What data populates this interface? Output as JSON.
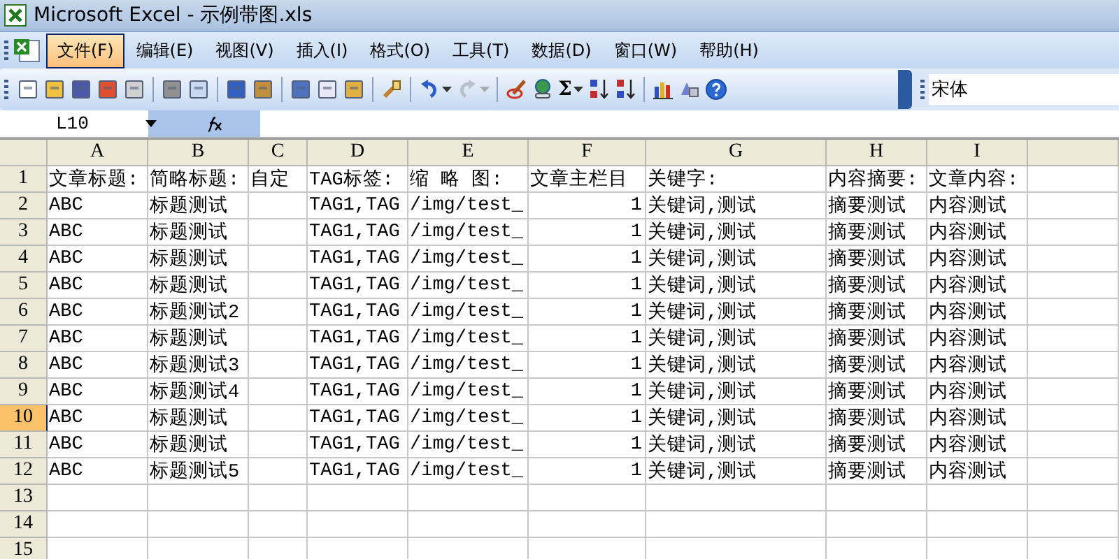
{
  "window": {
    "title": "Microsoft Excel - 示例带图.xls"
  },
  "menu": [
    {
      "label": "文件(F)",
      "selected": true
    },
    {
      "label": "编辑(E)",
      "selected": false
    },
    {
      "label": "视图(V)",
      "selected": false
    },
    {
      "label": "插入(I)",
      "selected": false
    },
    {
      "label": "格式(O)",
      "selected": false
    },
    {
      "label": "工具(T)",
      "selected": false
    },
    {
      "label": "数据(D)",
      "selected": false
    },
    {
      "label": "窗口(W)",
      "selected": false
    },
    {
      "label": "帮助(H)",
      "selected": false
    }
  ],
  "toolbar": {
    "sum_symbol": "Σ",
    "font_name": "宋体"
  },
  "formula_bar": {
    "name_box": "L10"
  },
  "columns": [
    "A",
    "B",
    "C",
    "D",
    "E",
    "F",
    "G",
    "H",
    "I"
  ],
  "rows": [
    {
      "number": "1",
      "selected": false,
      "cells": [
        "文章标题:",
        "简略标题:",
        "自定",
        "TAG标签:",
        "缩 略 图:",
        "文章主栏目",
        "关键字:",
        "内容摘要:",
        "文章内容:"
      ]
    },
    {
      "number": "2",
      "selected": false,
      "cells": [
        "ABC",
        "标题测试",
        "",
        "TAG1,TAG",
        "/img/test_",
        "1",
        "关键词,测试",
        "摘要测试",
        "内容测试"
      ]
    },
    {
      "number": "3",
      "selected": false,
      "cells": [
        "ABC",
        "标题测试",
        "",
        "TAG1,TAG",
        "/img/test_",
        "1",
        "关键词,测试",
        "摘要测试",
        "内容测试"
      ]
    },
    {
      "number": "4",
      "selected": false,
      "cells": [
        "ABC",
        "标题测试",
        "",
        "TAG1,TAG",
        "/img/test_",
        "1",
        "关键词,测试",
        "摘要测试",
        "内容测试"
      ]
    },
    {
      "number": "5",
      "selected": false,
      "cells": [
        "ABC",
        "标题测试",
        "",
        "TAG1,TAG",
        "/img/test_",
        "1",
        "关键词,测试",
        "摘要测试",
        "内容测试"
      ]
    },
    {
      "number": "6",
      "selected": false,
      "cells": [
        "ABC",
        "标题测试2",
        "",
        "TAG1,TAG",
        "/img/test_",
        "1",
        "关键词,测试",
        "摘要测试",
        "内容测试"
      ]
    },
    {
      "number": "7",
      "selected": false,
      "cells": [
        "ABC",
        "标题测试",
        "",
        "TAG1,TAG",
        "/img/test_",
        "1",
        "关键词,测试",
        "摘要测试",
        "内容测试"
      ]
    },
    {
      "number": "8",
      "selected": false,
      "cells": [
        "ABC",
        "标题测试3",
        "",
        "TAG1,TAG",
        "/img/test_",
        "1",
        "关键词,测试",
        "摘要测试",
        "内容测试"
      ]
    },
    {
      "number": "9",
      "selected": false,
      "cells": [
        "ABC",
        "标题测试4",
        "",
        "TAG1,TAG",
        "/img/test_",
        "1",
        "关键词,测试",
        "摘要测试",
        "内容测试"
      ]
    },
    {
      "number": "10",
      "selected": true,
      "cells": [
        "ABC",
        "标题测试",
        "",
        "TAG1,TAG",
        "/img/test_",
        "1",
        "关键词,测试",
        "摘要测试",
        "内容测试"
      ]
    },
    {
      "number": "11",
      "selected": false,
      "cells": [
        "ABC",
        "标题测试",
        "",
        "TAG1,TAG",
        "/img/test_",
        "1",
        "关键词,测试",
        "摘要测试",
        "内容测试"
      ]
    },
    {
      "number": "12",
      "selected": false,
      "cells": [
        "ABC",
        "标题测试5",
        "",
        "TAG1,TAG",
        "/img/test_",
        "1",
        "关键词,测试",
        "摘要测试",
        "内容测试"
      ]
    },
    {
      "number": "13",
      "selected": false,
      "cells": []
    },
    {
      "number": "14",
      "selected": false,
      "cells": []
    },
    {
      "number": "15",
      "selected": false,
      "cells": []
    }
  ]
}
